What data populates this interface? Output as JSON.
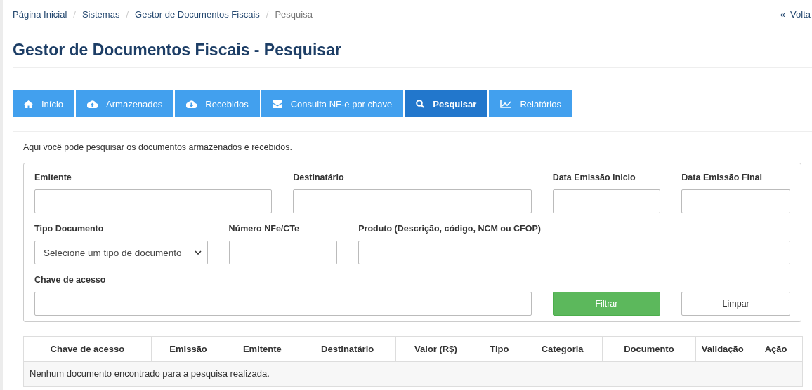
{
  "breadcrumb": [
    {
      "label": "Página Inicial",
      "current": false
    },
    {
      "label": "Sistemas",
      "current": false
    },
    {
      "label": "Gestor de Documentos Fiscais",
      "current": false
    },
    {
      "label": "Pesquisa",
      "current": true
    }
  ],
  "breadcrumb_separator": "/",
  "back": {
    "icon": "«",
    "label": "Volta"
  },
  "title": "Gestor de Documentos Fiscais - Pesquisar",
  "tabs": [
    {
      "label": "Início",
      "selected": false
    },
    {
      "label": "Armazenados",
      "selected": false
    },
    {
      "label": "Recebidos",
      "selected": false
    },
    {
      "label": "Consulta NF-e por chave",
      "selected": false
    },
    {
      "label": "Pesquisar",
      "selected": true
    },
    {
      "label": "Relatórios",
      "selected": false
    }
  ],
  "intro": "Aqui você pode pesquisar os documentos armazenados e recebidos.",
  "filters": [
    {
      "kind": "input",
      "label": "Emitente"
    },
    {
      "kind": "input",
      "label": "Destinatário"
    },
    {
      "kind": "input",
      "label": "Data Emissão Inicio"
    },
    {
      "kind": "input",
      "label": "Data Emissão Final"
    },
    {
      "kind": "select",
      "label": "Tipo Documento",
      "value": "Selecione um tipo de documento"
    },
    {
      "kind": "input",
      "label": "Número NFe/CTe"
    },
    {
      "kind": "input",
      "label": "Produto (Descrição, código, NCM ou CFOP)"
    },
    {
      "kind": "input",
      "label": "Chave de acesso"
    }
  ],
  "buttons": [
    {
      "kind": "primary",
      "label": "Filtrar"
    },
    {
      "kind": "default",
      "label": "Limpar"
    }
  ],
  "table": {
    "columns": [
      "Chave de acesso",
      "Emissão",
      "Emitente",
      "Destinatário",
      "Valor (R$)",
      "Tipo",
      "Categoria",
      "Documento",
      "Validação",
      "Ação"
    ],
    "empty": "Nenhum documento encontrado para a pesquisa realizada."
  }
}
